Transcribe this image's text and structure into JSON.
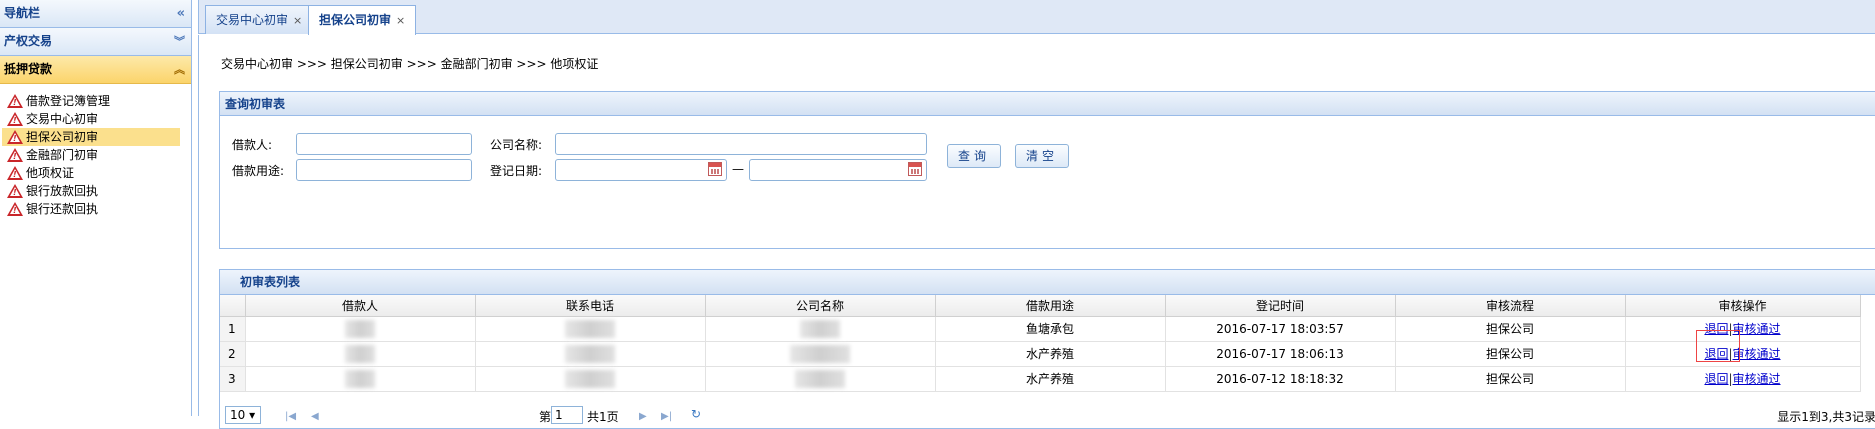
{
  "sidebar": {
    "nav_title": "导航栏",
    "sections": [
      {
        "label": "产权交易"
      },
      {
        "label": "抵押贷款"
      }
    ],
    "items": [
      {
        "label": "借款登记簿管理"
      },
      {
        "label": "交易中心初审"
      },
      {
        "label": "担保公司初审"
      },
      {
        "label": "金融部门初审"
      },
      {
        "label": "他项权证"
      },
      {
        "label": "银行放款回执"
      },
      {
        "label": "银行还款回执"
      }
    ],
    "collapse_icon": "«",
    "expand_icon": "»",
    "selected_index": 2
  },
  "tabs": [
    {
      "label": "交易中心初审"
    },
    {
      "label": "担保公司初审"
    }
  ],
  "tab_close": "×",
  "breadcrumb": "交易中心初审 >>> 担保公司初审 >>> 金融部门初审 >>> 他项权证",
  "query": {
    "title": "查询初审表",
    "borrower_label": "借款人:",
    "company_label": "公司名称:",
    "purpose_label": "借款用途:",
    "date_label": "登记日期:",
    "date_sep": "—",
    "search_button": "查询",
    "clear_button": "清空"
  },
  "list": {
    "title": "初审表列表",
    "columns": [
      "借款人",
      "联系电话",
      "公司名称",
      "借款用途",
      "登记时间",
      "审核流程",
      "审核操作"
    ],
    "rows": [
      {
        "num": "1",
        "purpose": "鱼塘承包",
        "time": "2016-07-17 18:03:57",
        "flow": "担保公司",
        "action_back": "退回",
        "action_pass": "审核通过"
      },
      {
        "num": "2",
        "purpose": "水产养殖",
        "time": "2016-07-17 18:06:13",
        "flow": "担保公司",
        "action_back": "退回",
        "action_pass": "审核通过"
      },
      {
        "num": "3",
        "purpose": "水产养殖",
        "time": "2016-07-12 18:18:32",
        "flow": "担保公司",
        "action_back": "退回",
        "action_pass": "审核通过"
      }
    ]
  },
  "pager": {
    "page_size": "10",
    "page_prefix": "第",
    "page_value": "1",
    "page_total": "共1页",
    "summary": "显示1到3,共3记录"
  },
  "colors": {
    "accent": "#15428b",
    "border": "#99bbe8",
    "selected": "#fbe08d",
    "link": "#0000cc"
  }
}
